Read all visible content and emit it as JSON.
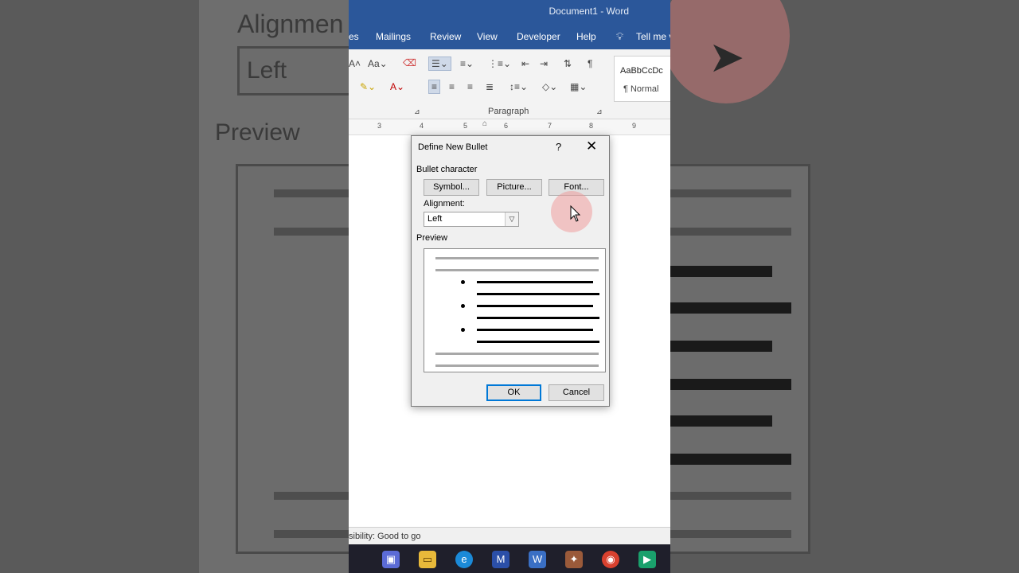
{
  "window": {
    "title": "Document1  -  Word"
  },
  "tabs": [
    {
      "label": "es"
    },
    {
      "label": "Mailings"
    },
    {
      "label": "Review"
    },
    {
      "label": "View"
    },
    {
      "label": "Developer"
    },
    {
      "label": "Help"
    },
    {
      "label": "Tell me v"
    }
  ],
  "ribbon": {
    "paragraph_group_label": "Paragraph",
    "style_preview_text": "AaBbCcDc",
    "style_name": "¶ Normal"
  },
  "ruler": {
    "marks": [
      "3",
      "4",
      "5",
      "6",
      "7",
      "8",
      "9"
    ]
  },
  "dialog": {
    "title": "Define New Bullet",
    "help_glyph": "?",
    "close_glyph": "✕",
    "bullet_character_label": "Bullet character",
    "symbol_button": "Symbol...",
    "picture_button": "Picture...",
    "font_button": "Font...",
    "alignment_label": "Alignment:",
    "alignment_value": "Left",
    "preview_label": "Preview",
    "ok_button": "OK",
    "cancel_button": "Cancel"
  },
  "status_bar": {
    "accessibility_text": "sibility: Good to go"
  },
  "background_zoom": {
    "alignment_label": "Alignmen",
    "alignment_value": "Left",
    "preview_label": "Preview"
  },
  "colors": {
    "title_bar": "#2b579a",
    "dialog_bg": "#f0f0f0",
    "taskbar": "#1f1f2b",
    "default_button_border": "#0078d7"
  }
}
